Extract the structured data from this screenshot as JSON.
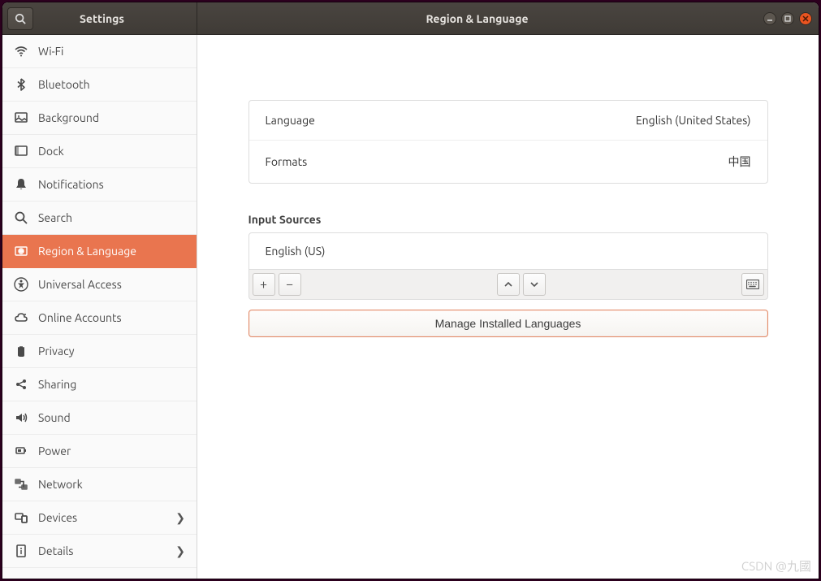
{
  "titlebar": {
    "app_title": "Settings",
    "page_title": "Region & Language"
  },
  "sidebar": {
    "items": [
      {
        "icon": "wifi",
        "label": "Wi-Fi",
        "selected": false,
        "chevron": false
      },
      {
        "icon": "bluetooth",
        "label": "Bluetooth",
        "selected": false,
        "chevron": false
      },
      {
        "icon": "background",
        "label": "Background",
        "selected": false,
        "chevron": false
      },
      {
        "icon": "dock",
        "label": "Dock",
        "selected": false,
        "chevron": false
      },
      {
        "icon": "bell",
        "label": "Notifications",
        "selected": false,
        "chevron": false
      },
      {
        "icon": "search",
        "label": "Search",
        "selected": false,
        "chevron": false
      },
      {
        "icon": "globe",
        "label": "Region & Language",
        "selected": true,
        "chevron": false
      },
      {
        "icon": "accessibility",
        "label": "Universal Access",
        "selected": false,
        "chevron": false
      },
      {
        "icon": "cloud",
        "label": "Online Accounts",
        "selected": false,
        "chevron": false
      },
      {
        "icon": "hand",
        "label": "Privacy",
        "selected": false,
        "chevron": false
      },
      {
        "icon": "share",
        "label": "Sharing",
        "selected": false,
        "chevron": false
      },
      {
        "icon": "speaker",
        "label": "Sound",
        "selected": false,
        "chevron": false
      },
      {
        "icon": "power",
        "label": "Power",
        "selected": false,
        "chevron": false
      },
      {
        "icon": "network",
        "label": "Network",
        "selected": false,
        "chevron": false
      },
      {
        "icon": "devices",
        "label": "Devices",
        "selected": false,
        "chevron": true
      },
      {
        "icon": "details",
        "label": "Details",
        "selected": false,
        "chevron": true
      }
    ]
  },
  "main": {
    "language_label": "Language",
    "language_value": "English (United States)",
    "formats_label": "Formats",
    "formats_value": "中国",
    "input_sources_heading": "Input Sources",
    "input_sources": [
      {
        "name": "English (US)"
      }
    ],
    "manage_button": "Manage Installed Languages"
  },
  "watermark": "CSDN @九國"
}
